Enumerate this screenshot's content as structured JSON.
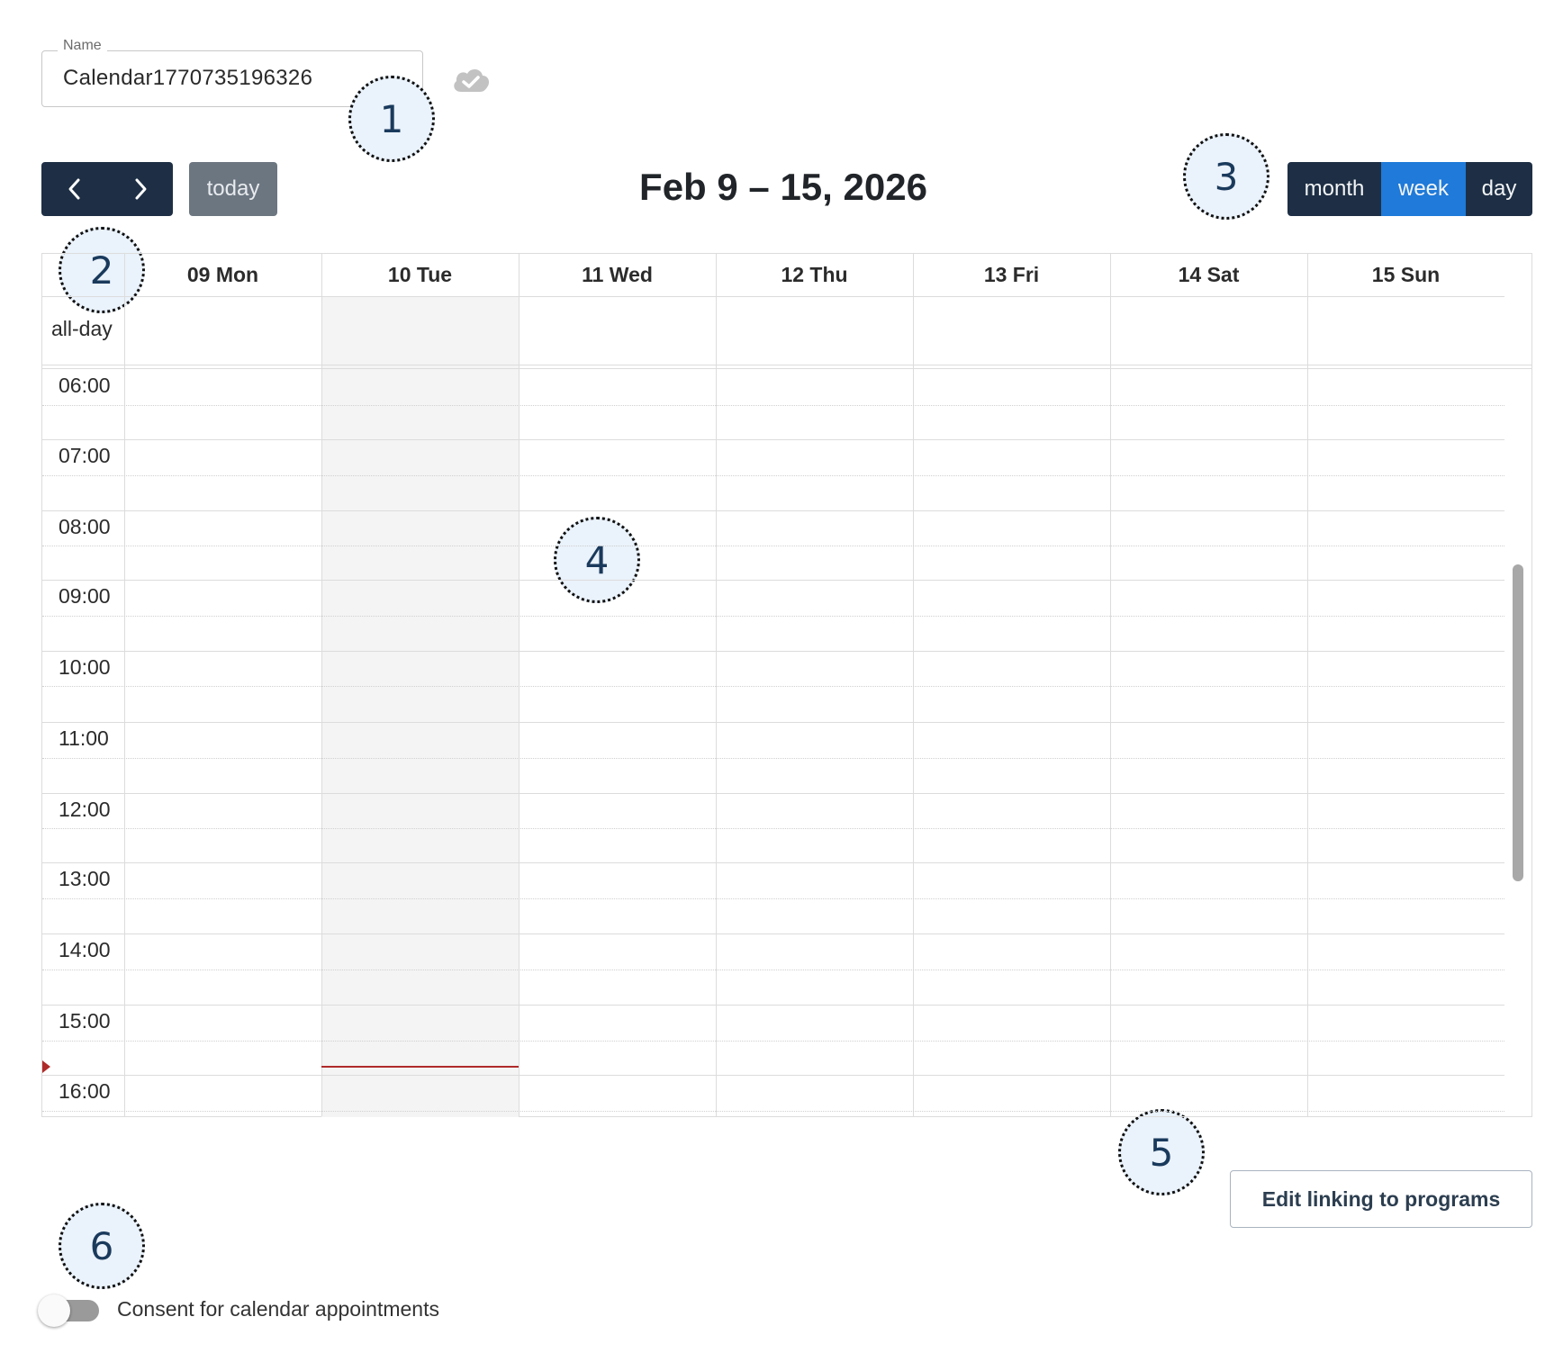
{
  "name_field": {
    "legend": "Name",
    "value": "Calendar1770735196326"
  },
  "toolbar": {
    "today_label": "today",
    "range_title": "Feb 9 – 15, 2026",
    "views": [
      {
        "label": "month",
        "active": false
      },
      {
        "label": "week",
        "active": true
      },
      {
        "label": "day",
        "active": false
      }
    ]
  },
  "calendar": {
    "allday_label": "all-day",
    "days": [
      "09 Mon",
      "10 Tue",
      "11 Wed",
      "12 Thu",
      "13 Fri",
      "14 Sat",
      "15 Sun"
    ],
    "today_index": 1,
    "times": [
      "06:00",
      "07:00",
      "08:00",
      "09:00",
      "10:00",
      "11:00",
      "12:00",
      "13:00",
      "14:00",
      "15:00",
      "16:00"
    ]
  },
  "callouts": [
    "1",
    "2",
    "3",
    "4",
    "5",
    "6"
  ],
  "edit_button_label": "Edit linking to programs",
  "consent": {
    "label": "Consent for calendar appointments",
    "enabled": false
  },
  "colors": {
    "toolbar_dark": "#1e2f45",
    "active_view": "#1f7ad9",
    "now_indicator": "#b02a2a"
  }
}
